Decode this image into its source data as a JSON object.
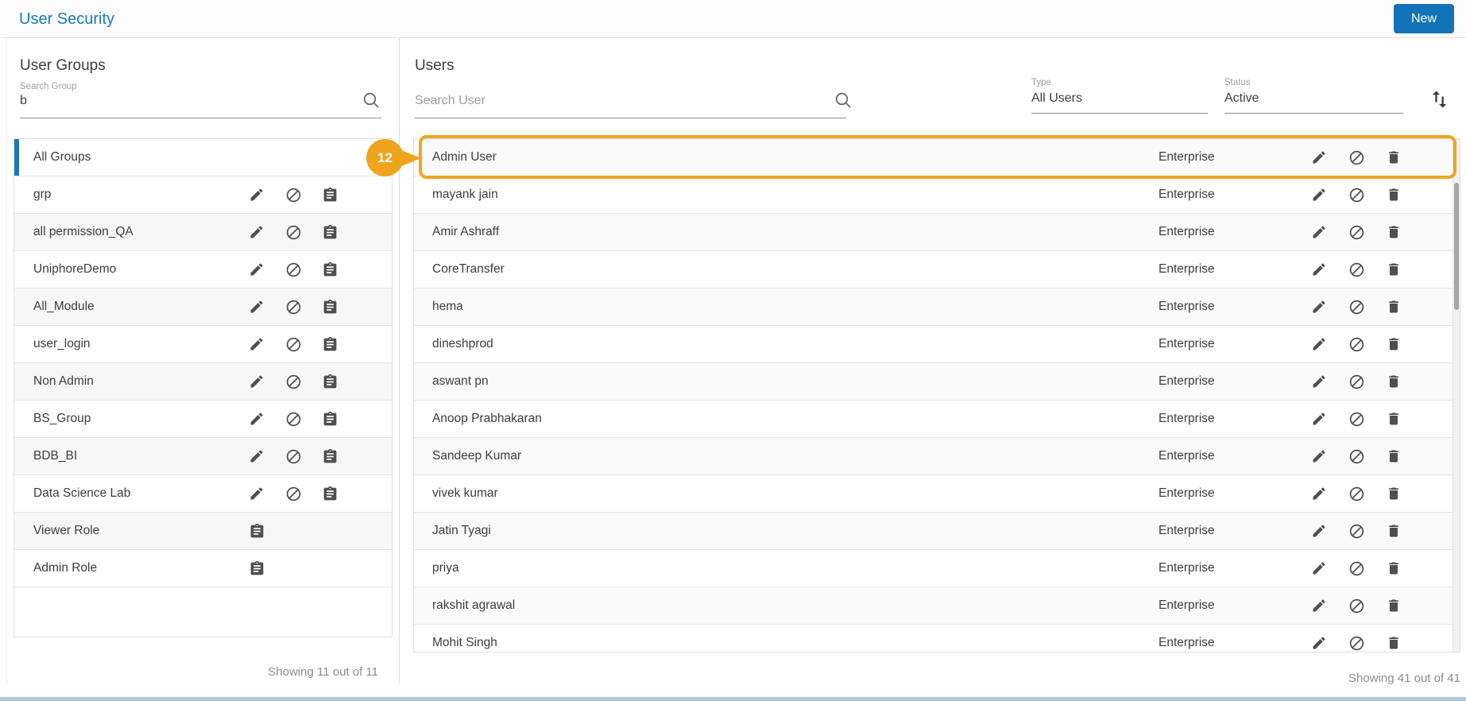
{
  "header": {
    "title": "User Security",
    "new_button_label": "New"
  },
  "colors": {
    "title_blue": "#1878be",
    "button_blue": "#1273b8",
    "annotation_orange": "#f0a41d",
    "selected_bar_blue": "#1878be"
  },
  "annotation": {
    "label": "12"
  },
  "groups_panel": {
    "title": "User Groups",
    "search_label": "Search Group",
    "search_value": "b",
    "footer": "Showing 11 out of 11",
    "items": [
      {
        "name": "All Groups",
        "selected": true,
        "actions": []
      },
      {
        "name": "grp",
        "actions": [
          "edit",
          "block",
          "assignment"
        ]
      },
      {
        "name": "all permission_QA",
        "actions": [
          "edit",
          "block",
          "assignment"
        ]
      },
      {
        "name": "UniphoreDemo",
        "actions": [
          "edit",
          "block",
          "assignment"
        ]
      },
      {
        "name": "All_Module",
        "actions": [
          "edit",
          "block",
          "assignment"
        ]
      },
      {
        "name": "user_login",
        "actions": [
          "edit",
          "block",
          "assignment"
        ]
      },
      {
        "name": "Non Admin",
        "actions": [
          "edit",
          "block",
          "assignment"
        ]
      },
      {
        "name": "BS_Group",
        "actions": [
          "edit",
          "block",
          "assignment"
        ]
      },
      {
        "name": "BDB_BI",
        "actions": [
          "edit",
          "block",
          "assignment"
        ]
      },
      {
        "name": "Data Science Lab",
        "actions": [
          "edit",
          "block",
          "assignment"
        ]
      },
      {
        "name": "Viewer Role",
        "actions": [
          "assignment"
        ]
      },
      {
        "name": "Admin Role",
        "actions": [
          "assignment"
        ]
      }
    ]
  },
  "users_panel": {
    "title": "Users",
    "search_placeholder": "Search User",
    "type_filter": {
      "label": "Type",
      "value": "All Users"
    },
    "status_filter": {
      "label": "Status",
      "value": "Active"
    },
    "footer": "Showing 41 out of 41",
    "items": [
      {
        "name": "Admin User",
        "type": "Enterprise",
        "highlighted": true
      },
      {
        "name": "mayank jain",
        "type": "Enterprise"
      },
      {
        "name": "Amir Ashraff",
        "type": "Enterprise"
      },
      {
        "name": "CoreTransfer",
        "type": "Enterprise"
      },
      {
        "name": "hema",
        "type": "Enterprise"
      },
      {
        "name": "dineshprod",
        "type": "Enterprise"
      },
      {
        "name": "aswant pn",
        "type": "Enterprise"
      },
      {
        "name": "Anoop Prabhakaran",
        "type": "Enterprise"
      },
      {
        "name": "Sandeep Kumar",
        "type": "Enterprise"
      },
      {
        "name": "vivek kumar",
        "type": "Enterprise"
      },
      {
        "name": "Jatin Tyagi",
        "type": "Enterprise"
      },
      {
        "name": "priya",
        "type": "Enterprise"
      },
      {
        "name": "rakshit agrawal",
        "type": "Enterprise"
      },
      {
        "name": "Mohit Singh",
        "type": "Enterprise"
      }
    ]
  }
}
